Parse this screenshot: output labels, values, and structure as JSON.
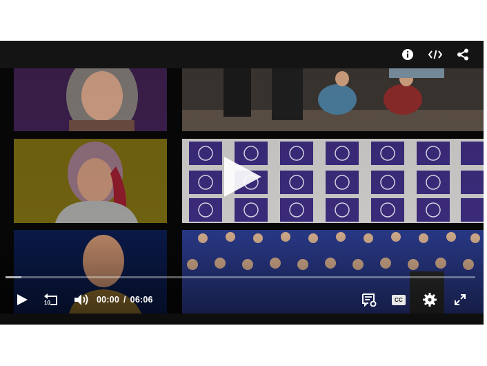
{
  "player": {
    "time": {
      "current": "00:00",
      "separator": "/",
      "duration": "06:06"
    },
    "progress": {
      "played_fraction": 0.0,
      "buffered_fraction": 0.034
    },
    "captions_label": "CC",
    "replay_seconds": "10",
    "icons": {
      "info": "info-icon",
      "embed": "embed-code-icon",
      "share": "share-icon",
      "play_big": "play-icon",
      "play": "play-icon",
      "replay": "replay-10-icon",
      "volume": "volume-icon",
      "transcript": "transcript-settings-icon",
      "captions": "closed-captions-icon",
      "settings": "gear-icon",
      "fullscreen": "fullscreen-icon"
    },
    "colors": {
      "accent": "#ffffff",
      "chrome": "#141414"
    }
  }
}
